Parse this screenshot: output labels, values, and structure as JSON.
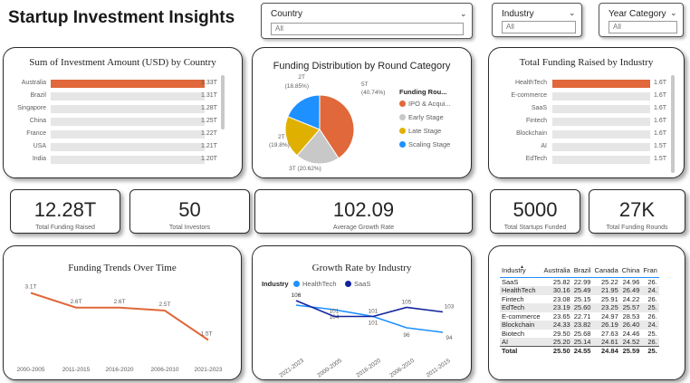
{
  "page_title": "Startup Investment Insights",
  "slicers": {
    "country": {
      "label": "Country",
      "value": "All"
    },
    "industry": {
      "label": "Industry",
      "value": "All"
    },
    "year_category": {
      "label": "Year Category",
      "value": "All"
    }
  },
  "kpis": {
    "total_funding": {
      "value": "12.28T",
      "label": "Total Funding Raised"
    },
    "investors": {
      "value": "50",
      "label": "Total Investors"
    },
    "growth": {
      "value": "102.09",
      "label": "Average Growth Rate"
    },
    "startups": {
      "value": "5000",
      "label": "Total Startups Funded"
    },
    "rounds": {
      "value": "27K",
      "label": "Total Funding Rounds"
    }
  },
  "colors": {
    "accent": "#e0683a",
    "track": "#e6e6e6",
    "grey": "#c8c8c8",
    "yellow": "#e0b000",
    "blue": "#1e90ff",
    "light_blue": "#1e90ff",
    "dark_blue": "#12239e"
  },
  "chart_data": [
    {
      "type": "bar",
      "id": "country",
      "title": "Sum of Investment Amount (USD) by Country",
      "categories": [
        "Australia",
        "Brazil",
        "Singapore",
        "China",
        "France",
        "USA",
        "India"
      ],
      "values": [
        1.33,
        1.31,
        1.28,
        1.25,
        1.22,
        1.21,
        1.2
      ],
      "labels": [
        "1.33T",
        "1.31T",
        "1.28T",
        "1.25T",
        "1.22T",
        "1.21T",
        "1.20T"
      ],
      "highlight_index": 0
    },
    {
      "type": "pie",
      "id": "round",
      "title": "Funding Distribution by Round Category",
      "legend_title": "Funding Rou...",
      "slices": [
        {
          "name": "IPO & Acqui...",
          "value": 5,
          "label": "5T",
          "pct": "(40.74%)",
          "color": "#e0683a"
        },
        {
          "name": "Early Stage",
          "value": 3,
          "label": "3T (20.62%)",
          "pct": "",
          "color": "#c8c8c8"
        },
        {
          "name": "Late Stage",
          "value": 2,
          "label": "2T",
          "pct": "(19.8%)",
          "color": "#e0b000"
        },
        {
          "name": "Scaling Stage",
          "value": 2,
          "label": "2T",
          "pct": "(18.85%)",
          "color": "#1e90ff"
        }
      ]
    },
    {
      "type": "bar",
      "id": "industry",
      "title": "Total Funding Raised by Industry",
      "categories": [
        "HealthTech",
        "E-commerce",
        "SaaS",
        "Fintech",
        "Blockchain",
        "AI",
        "EdTech"
      ],
      "values": [
        1.6,
        1.6,
        1.6,
        1.6,
        1.6,
        1.5,
        1.5
      ],
      "labels": [
        "1.6T",
        "1.6T",
        "1.6T",
        "1.6T",
        "1.6T",
        "1.5T",
        "1.5T"
      ],
      "highlight_index": 0
    },
    {
      "type": "line",
      "id": "trend",
      "title": "Funding Trends Over Time",
      "categories": [
        "2000-2005",
        "2011-2015",
        "2016-2020",
        "2006-2010",
        "2021-2023"
      ],
      "values": [
        3.1,
        2.6,
        2.6,
        2.5,
        1.5
      ],
      "labels": [
        "3.1T",
        "2.6T",
        "2.6T",
        "2.5T",
        "1.5T"
      ],
      "color": "#e0683a"
    },
    {
      "type": "line",
      "id": "growth",
      "title": "Growth Rate by Industry",
      "legend_title": "Industry",
      "categories": [
        "2021-2023",
        "2000-2005",
        "2016-2020",
        "2006-2010",
        "2011-2015"
      ],
      "series": [
        {
          "name": "HealthTech",
          "values": [
            106,
            104,
            101,
            96,
            94
          ],
          "color": "#1e90ff"
        },
        {
          "name": "SaaS",
          "values": [
            108,
            101,
            101,
            105,
            103
          ],
          "color": "#12239e"
        }
      ],
      "top_label": "108"
    }
  ],
  "matrix": {
    "headers": [
      "Industry",
      "Australia",
      "Brazil",
      "Canada",
      "China",
      "Fran"
    ],
    "rows": [
      [
        "SaaS",
        "25.82",
        "22.99",
        "25.22",
        "24.96",
        "26."
      ],
      [
        "HealthTech",
        "30.16",
        "25.49",
        "21.95",
        "26.49",
        "24."
      ],
      [
        "Fintech",
        "23.08",
        "25.15",
        "25.91",
        "24.22",
        "26."
      ],
      [
        "EdTech",
        "23.19",
        "25.60",
        "23.25",
        "25.57",
        "25."
      ],
      [
        "E-commerce",
        "23.65",
        "22.71",
        "24.97",
        "28.53",
        "26."
      ],
      [
        "Blockchain",
        "24.33",
        "23.82",
        "26.19",
        "26.40",
        "24."
      ],
      [
        "Biotech",
        "29.50",
        "25.68",
        "27.63",
        "24.46",
        "25."
      ],
      [
        "AI",
        "25.20",
        "25.14",
        "24.61",
        "24.52",
        "26."
      ]
    ],
    "total": [
      "Total",
      "25.50",
      "24.55",
      "24.84",
      "25.59",
      "25."
    ]
  }
}
